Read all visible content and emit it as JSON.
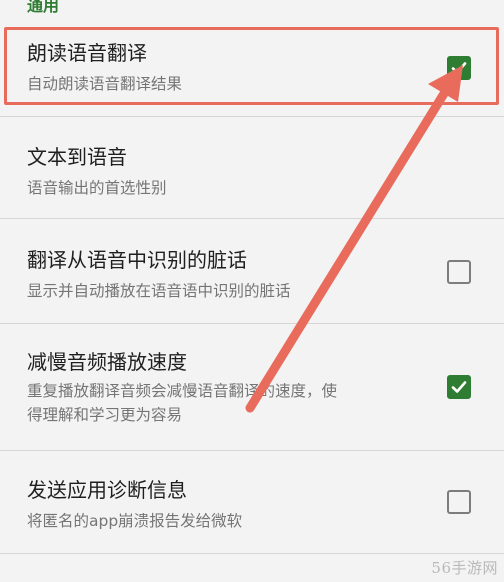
{
  "section": {
    "header": "通用"
  },
  "settings": [
    {
      "title": "朗读语音翻译",
      "summary": "自动朗读语音翻译结果",
      "checkbox": "checked"
    },
    {
      "title": "文本到语音",
      "summary": "语音输出的首选性别",
      "checkbox": "none"
    },
    {
      "title": "翻译从语音中识别的脏话",
      "summary": "显示并自动播放在语音语中识别的脏话",
      "checkbox": "unchecked"
    },
    {
      "title": "减慢音频播放速度",
      "summary_line1": "重复播放翻译音频会减慢语音翻译的速度，使",
      "summary_line2": "得理解和学习更为容易",
      "checkbox": "checked"
    },
    {
      "title": "发送应用诊断信息",
      "summary": "将匿名的app崩溃报告发给微软",
      "checkbox": "unchecked"
    }
  ],
  "watermark": "56手游网",
  "colors": {
    "accent": "#2e7d32",
    "annotation": "#e86b5c",
    "background": "#f3f3f3"
  }
}
